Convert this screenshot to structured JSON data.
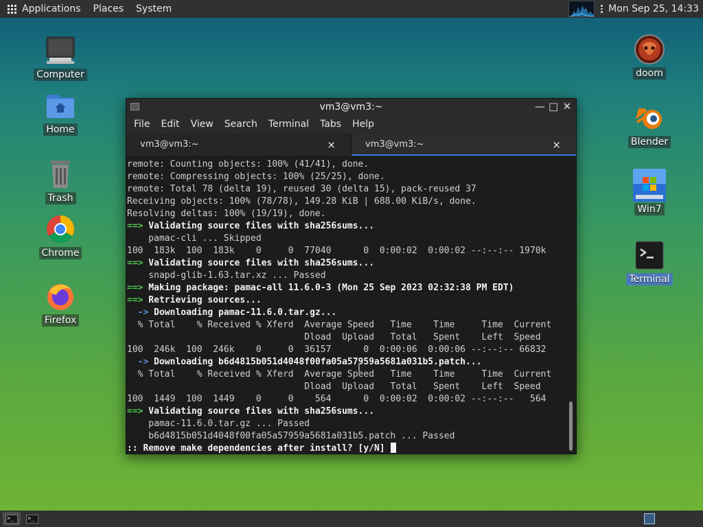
{
  "top_panel": {
    "menus": [
      "Applications",
      "Places",
      "System"
    ],
    "clock": "Mon Sep 25, 14:33"
  },
  "desktop": {
    "left_icons": [
      {
        "label": "Computer",
        "icon": "computer-icon"
      },
      {
        "label": "Home",
        "icon": "home-folder-icon"
      },
      {
        "label": "Trash",
        "icon": "trash-icon"
      },
      {
        "label": "Chrome",
        "icon": "chrome-icon"
      },
      {
        "label": "Firefox",
        "icon": "firefox-icon"
      }
    ],
    "right_icons": [
      {
        "label": "doom",
        "icon": "doom-icon"
      },
      {
        "label": "Blender",
        "icon": "blender-icon"
      },
      {
        "label": "Win7",
        "icon": "windows7-icon"
      },
      {
        "label": "Terminal",
        "icon": "terminal-icon"
      }
    ]
  },
  "terminal": {
    "title": "vm3@vm3:~",
    "menu": [
      "File",
      "Edit",
      "View",
      "Search",
      "Terminal",
      "Tabs",
      "Help"
    ],
    "tabs": [
      {
        "label": "vm3@vm3:~",
        "close": "×"
      },
      {
        "label": "vm3@vm3:~",
        "close": "×"
      }
    ],
    "lines": [
      {
        "prefix": "",
        "text": "remote: Counting objects: 100% (41/41), done.",
        "style": "normal"
      },
      {
        "prefix": "",
        "text": "remote: Compressing objects: 100% (25/25), done.",
        "style": "normal"
      },
      {
        "prefix": "",
        "text": "remote: Total 78 (delta 19), reused 30 (delta 15), pack-reused 37",
        "style": "normal"
      },
      {
        "prefix": "",
        "text": "Receiving objects: 100% (78/78), 149.28 KiB | 688.00 KiB/s, done.",
        "style": "normal"
      },
      {
        "prefix": "",
        "text": "Resolving deltas: 100% (19/19), done.",
        "style": "normal"
      },
      {
        "prefix": "==>",
        "text": " Validating source files with sha256sums...",
        "style": "green"
      },
      {
        "prefix": "",
        "text": "    pamac-cli ... Skipped",
        "style": "normal"
      },
      {
        "prefix": "",
        "text": "100  183k  100  183k    0     0  77040      0  0:00:02  0:00:02 --:--:-- 1970k",
        "style": "normal"
      },
      {
        "prefix": "==>",
        "text": " Validating source files with sha256sums...",
        "style": "green"
      },
      {
        "prefix": "",
        "text": "    snapd-glib-1.63.tar.xz ... Passed",
        "style": "normal"
      },
      {
        "prefix": "==>",
        "text": " Making package: pamac-all 11.6.0-3 (Mon 25 Sep 2023 02:32:38 PM EDT)",
        "style": "green"
      },
      {
        "prefix": "==>",
        "text": " Retrieving sources...",
        "style": "green"
      },
      {
        "prefix": "  ->",
        "text": " Downloading pamac-11.6.0.tar.gz...",
        "style": "blue"
      },
      {
        "prefix": "",
        "text": "  % Total    % Received % Xferd  Average Speed   Time    Time     Time  Current",
        "style": "normal"
      },
      {
        "prefix": "",
        "text": "                                 Dload  Upload   Total   Spent    Left  Speed",
        "style": "normal"
      },
      {
        "prefix": "",
        "text": "100  246k  100  246k    0     0  36157      0  0:00:06  0:00:06 --:--:-- 66832",
        "style": "normal"
      },
      {
        "prefix": "  ->",
        "text": " Downloading b6d4815b051d4048f00fa05a57959a5681a031b5.patch...",
        "style": "blue"
      },
      {
        "prefix": "",
        "text": "  % Total    % Received % Xferd  Average Speed   Time    Time     Time  Current",
        "style": "normal"
      },
      {
        "prefix": "",
        "text": "                                 Dload  Upload   Total   Spent    Left  Speed",
        "style": "normal"
      },
      {
        "prefix": "",
        "text": "100  1449  100  1449    0     0    564      0  0:00:02  0:00:02 --:--:--   564",
        "style": "normal"
      },
      {
        "prefix": "==>",
        "text": " Validating source files with sha256sums...",
        "style": "green"
      },
      {
        "prefix": "",
        "text": "    pamac-11.6.0.tar.gz ... Passed",
        "style": "normal"
      },
      {
        "prefix": "",
        "text": "    b6d4815b051d4048f00fa05a57959a5681a031b5.patch ... Passed",
        "style": "normal"
      },
      {
        "prefix": "",
        "text": ":: Remove make dependencies after install? [y/N] ",
        "style": "bold"
      }
    ]
  },
  "colors": {
    "prompt_green": "#4ec94e",
    "prompt_blue": "#5c8fe0",
    "tab_accent": "#3584e4"
  }
}
